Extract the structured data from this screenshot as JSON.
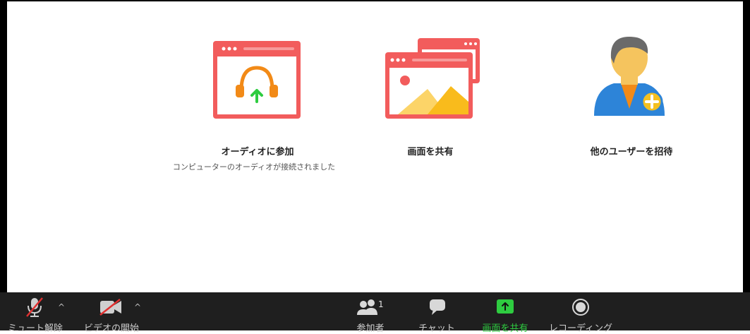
{
  "main": {
    "options": [
      {
        "label": "オーディオに参加",
        "sub": "コンピューターのオーディオが接続されました",
        "icon": "headphones-window-icon"
      },
      {
        "label": "画面を共有",
        "icon": "share-screen-windows-icon"
      },
      {
        "label": "他のユーザーを招待",
        "icon": "add-user-icon"
      }
    ]
  },
  "toolbar": {
    "mute_label": "ミュート解除",
    "video_label": "ビデオの開始",
    "participants_label": "参加者",
    "participants_count": "1",
    "chat_label": "チャット",
    "share_label": "画面を共有",
    "record_label": "レコーディング",
    "caret": "^"
  },
  "colors": {
    "accent_red": "#f25c5c",
    "headphone_orange": "#f28a17",
    "arrow_green": "#2ecc40",
    "toolbar_bg": "#1f1f1f",
    "share_green": "#2ecc40",
    "user_blue": "#2d84d8",
    "plus_yellow": "#f4c020"
  }
}
